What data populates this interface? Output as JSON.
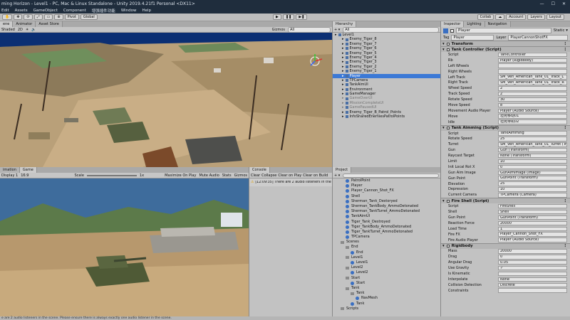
{
  "titlebar": {
    "title": "ming Horizon - Level1 - PC, Mac & Linux Standalone - Unity 2019.4.21f1 Personal <DX11>",
    "min": "—",
    "max": "☐",
    "close": "✕"
  },
  "menu": [
    "Edit",
    "Assets",
    "GameObject",
    "Component",
    "增强插件功能",
    "Window",
    "Help"
  ],
  "toolbar": {
    "pivot": "Pivot",
    "global": "Global",
    "collab": "Collab",
    "account": "Account",
    "layers": "Layers",
    "layout": "Layout"
  },
  "scene": {
    "tabs": [
      "ene",
      "Animator",
      "Asset Store"
    ],
    "shaded": "Shaded",
    "mode": "2D",
    "gizmos": "Gizmos",
    "search": "All"
  },
  "game": {
    "tabs": [
      "imation",
      "Game"
    ],
    "display": "Display 1",
    "aspect": "16:9",
    "scale_label": "Scale",
    "scale_value": "1x",
    "buttons": [
      "Maximize On Play",
      "Mute Audio",
      "Stats",
      "Gizmos"
    ]
  },
  "console": {
    "tab": "Console",
    "buttons": [
      "Clear",
      "Collapse",
      "Clear on Play",
      "Clear on Build"
    ],
    "message": "[12:09:35] There are 2 audio listeners in the"
  },
  "hierarchy": {
    "tab": "Hierarchy",
    "create": "+ ▾",
    "search": "All",
    "items": [
      {
        "label": "Level1",
        "depth": 0,
        "state": "root"
      },
      {
        "label": "Enemy_Tiger_8",
        "depth": 1,
        "state": ""
      },
      {
        "label": "Enemy_Tiger_7",
        "depth": 1,
        "state": ""
      },
      {
        "label": "Enemy_Tiger_6",
        "depth": 1,
        "state": ""
      },
      {
        "label": "Enemy_Tiger_5",
        "depth": 1,
        "state": ""
      },
      {
        "label": "Enemy_Tiger_4",
        "depth": 1,
        "state": ""
      },
      {
        "label": "Enemy_Tiger_3",
        "depth": 1,
        "state": ""
      },
      {
        "label": "Enemy_Tiger_2",
        "depth": 1,
        "state": ""
      },
      {
        "label": "Enemy_Tiger_1",
        "depth": 1,
        "state": ""
      },
      {
        "label": "Player",
        "depth": 1,
        "state": "selected"
      },
      {
        "label": "TPCamera",
        "depth": 1,
        "state": ""
      },
      {
        "label": "TankAimUI",
        "depth": 1,
        "state": ""
      },
      {
        "label": "Environment",
        "depth": 1,
        "state": ""
      },
      {
        "label": "GameManager",
        "depth": 1,
        "state": ""
      },
      {
        "label": "GameOverUI",
        "depth": 1,
        "state": "dim"
      },
      {
        "label": "MissionCompleteUI",
        "depth": 1,
        "state": "dim"
      },
      {
        "label": "GamePausedUI",
        "depth": 1,
        "state": "dim"
      },
      {
        "label": "Enemy_Tiger_B_Patrol_Points",
        "depth": 1,
        "state": ""
      },
      {
        "label": "InfoSharedEnemiesPatrolPoints",
        "depth": 1,
        "state": ""
      }
    ]
  },
  "project": {
    "tab": "Project",
    "items": [
      {
        "label": "PatrolPoint",
        "depth": 2,
        "kind": "prefab"
      },
      {
        "label": "Player",
        "depth": 2,
        "kind": "prefab"
      },
      {
        "label": "Player_Cannon_Shot_FX",
        "depth": 2,
        "kind": "prefab"
      },
      {
        "label": "Shell",
        "depth": 2,
        "kind": "prefab"
      },
      {
        "label": "Sherman_Tank_Destoryed",
        "depth": 2,
        "kind": "prefab"
      },
      {
        "label": "Sherman_TankBody_AmmoDetonated",
        "depth": 2,
        "kind": "prefab"
      },
      {
        "label": "Sherman_TankTurret_AmmoDetonated",
        "depth": 2,
        "kind": "prefab"
      },
      {
        "label": "TankAimUI",
        "depth": 2,
        "kind": "prefab"
      },
      {
        "label": "Tiger_Tank_Destroyed",
        "depth": 2,
        "kind": "prefab"
      },
      {
        "label": "Tiger_TankBody_AmmoDetonated",
        "depth": 2,
        "kind": "prefab"
      },
      {
        "label": "Tiger_TankTurret_AmmoDetonated",
        "depth": 2,
        "kind": "prefab"
      },
      {
        "label": "TPCamera",
        "depth": 2,
        "kind": "prefab"
      },
      {
        "label": "Scenes",
        "depth": 1,
        "kind": "folder"
      },
      {
        "label": "End",
        "depth": 2,
        "kind": "folder"
      },
      {
        "label": "End",
        "depth": 3,
        "kind": "scene"
      },
      {
        "label": "Level1",
        "depth": 2,
        "kind": "folder"
      },
      {
        "label": "Level1",
        "depth": 3,
        "kind": "scene"
      },
      {
        "label": "Level2",
        "depth": 2,
        "kind": "folder"
      },
      {
        "label": "Level2",
        "depth": 3,
        "kind": "scene"
      },
      {
        "label": "Start",
        "depth": 2,
        "kind": "folder"
      },
      {
        "label": "Start",
        "depth": 3,
        "kind": "scene"
      },
      {
        "label": "Tank",
        "depth": 2,
        "kind": "folder"
      },
      {
        "label": "Tank",
        "depth": 3,
        "kind": "folder"
      },
      {
        "label": "NavMesh",
        "depth": 4,
        "kind": "asset"
      },
      {
        "label": "Tank",
        "depth": 3,
        "kind": "scene"
      },
      {
        "label": "Scripts",
        "depth": 1,
        "kind": "folder"
      }
    ]
  },
  "inspector": {
    "tabs": [
      "Inspector",
      "Lighting",
      "Navigation"
    ],
    "name": "Player",
    "static": "Static ▾",
    "tag_label": "Tag",
    "tag": "Player",
    "layer_label": "Layer",
    "layer": "PlayerCannonShotFX",
    "components": [
      {
        "title": "Transform",
        "props": []
      },
      {
        "title": "Tank Controller (Script)",
        "props": [
          {
            "k": "Script",
            "v": "TankController"
          },
          {
            "k": "Rb",
            "v": "Player (Rigidbody)"
          },
          {
            "k": "Left Wheels",
            "v": ""
          },
          {
            "k": "Right Wheels",
            "v": ""
          },
          {
            "k": "Left Track",
            "v": "SM_Veh_American_Tank_01_Track_L"
          },
          {
            "k": "Right Track",
            "v": "SM_Veh_American_Tank_01_Track_R"
          },
          {
            "k": "Wheel Speed",
            "v": "2"
          },
          {
            "k": "Track Speed",
            "v": "2"
          },
          {
            "k": "Rotate Speed",
            "v": "30"
          },
          {
            "k": "Move Speed",
            "v": "8"
          },
          {
            "k": "Movement Audio Player",
            "v": "Player (Audio Source)"
          },
          {
            "k": "Move",
            "v": "坦克移动01"
          },
          {
            "k": "Idle",
            "v": "坦克待机02"
          }
        ]
      },
      {
        "title": "Tank Aimming (Script)",
        "props": [
          {
            "k": "Script",
            "v": "TankAimming"
          },
          {
            "k": "Rotate Speed",
            "v": "25"
          },
          {
            "k": "Turret",
            "v": "SM_Veh_American_Tank_01_Turret (Transform)"
          },
          {
            "k": "Gun",
            "v": "Gun (Transform)"
          },
          {
            "k": "Raycast Target",
            "v": "None (Transform)"
          },
          {
            "k": "Limit",
            "v": "10"
          },
          {
            "k": "Init Local Rot X",
            "v": "0"
          },
          {
            "k": "Gun Aim Image",
            "v": "GunAimImage (Image)"
          },
          {
            "k": "Gun Point",
            "v": "GunPoint (Transform)"
          },
          {
            "k": "Elevation",
            "v": "25"
          },
          {
            "k": "Depression",
            "v": "10"
          },
          {
            "k": "Current Camera",
            "v": "TPCamera (Camera)"
          }
        ]
      },
      {
        "title": "Fire Shell (Script)",
        "props": [
          {
            "k": "Script",
            "v": "FireShell"
          },
          {
            "k": "Shell",
            "v": "Shell"
          },
          {
            "k": "Gun Point",
            "v": "GunPoint (Transform)"
          },
          {
            "k": "Reaction Force",
            "v": "20000"
          },
          {
            "k": "Load Time",
            "v": "1"
          },
          {
            "k": "Fire FX",
            "v": "Player_Cannon_Shot_FX"
          },
          {
            "k": "Fire Audio Player",
            "v": "Player (Audio Source)"
          }
        ]
      },
      {
        "title": "Rigidbody",
        "props": [
          {
            "k": "Mass",
            "v": "20000"
          },
          {
            "k": "Drag",
            "v": "0"
          },
          {
            "k": "Angular Drag",
            "v": "0.05"
          },
          {
            "k": "Use Gravity",
            "v": "✓"
          },
          {
            "k": "Is Kinematic",
            "v": ""
          },
          {
            "k": "Interpolate",
            "v": "None"
          },
          {
            "k": "Collision Detection",
            "v": "Discrete"
          },
          {
            "k": "Constraints",
            "v": ""
          }
        ]
      }
    ]
  },
  "statusbar": {
    "text": "e are 2 audio listeners in the scene. Please ensure there is always exactly one audio listener in the scene."
  }
}
